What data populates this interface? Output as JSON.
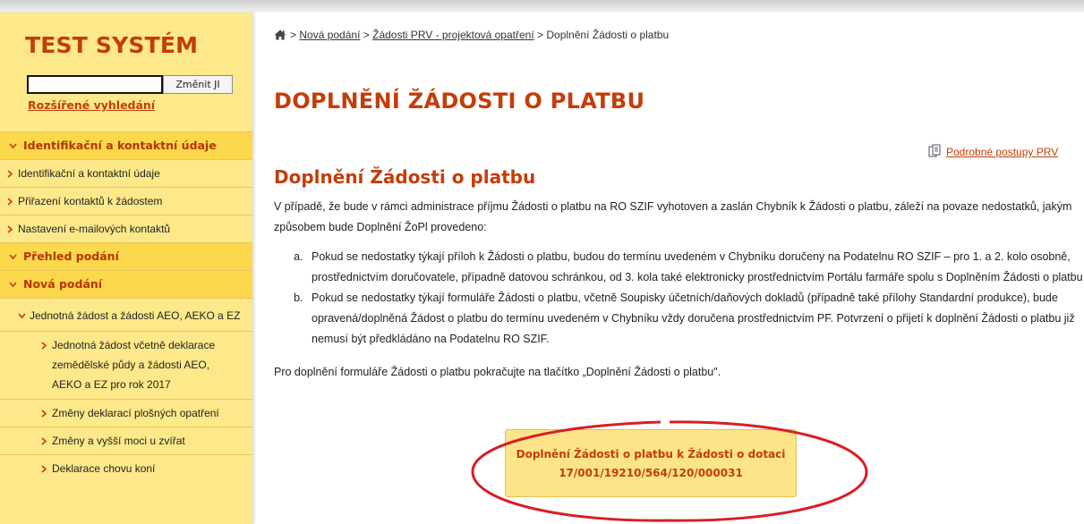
{
  "colors": {
    "accent": "#c43d08",
    "sidebar_bg": "#fde98a",
    "section_bg": "#fcd84d",
    "annotation": "#d81e26"
  },
  "sidebar": {
    "system_title": "TEST SYSTÉM",
    "search": {
      "value": "",
      "button_label": "Změnit JI"
    },
    "advanced_search": "Rozšířené vyhledání",
    "items": [
      {
        "label": "Identifikační a kontaktní údaje",
        "kind": "section"
      },
      {
        "label": "Identifikační a kontaktní údaje",
        "kind": "sub"
      },
      {
        "label": "Přiřazení kontaktů k žádostem",
        "kind": "sub"
      },
      {
        "label": "Nastavení e-mailových kontaktů",
        "kind": "sub"
      },
      {
        "label": "Přehled podání",
        "kind": "section"
      },
      {
        "label": "Nová podání",
        "kind": "section"
      },
      {
        "label": "Jednotná žádost a žádosti AEO, AEKO a EZ",
        "kind": "sub2"
      },
      {
        "label": "Jednotná žádost včetně deklarace zemědělské půdy a žádosti AEO, AEKO a EZ pro rok 2017",
        "kind": "sub3"
      },
      {
        "label": "Změny deklarací plošných opatření",
        "kind": "sub3"
      },
      {
        "label": "Změny a vyšší moci u zvířat",
        "kind": "sub3"
      },
      {
        "label": "Deklarace chovu koní",
        "kind": "sub3"
      }
    ]
  },
  "breadcrumb": {
    "home_icon": "home-icon",
    "links": [
      "Nová podání",
      "Žádosti PRV - projektová opatření"
    ],
    "current": "Doplnění Žádosti o platbu",
    "separator": ">"
  },
  "page_title": "DOPLNĚNÍ ŽÁDOSTI O PLATBU",
  "detail_link": "Podrobné postupy PRV",
  "section_title": "Doplnění Žádosti o platbu",
  "intro": "V případě, že bude v rámci administrace příjmu Žádosti o platbu na RO SZIF vyhotoven a zaslán Chybník k Žádosti o platbu, záleží na povaze nedostatků, jakým způsobem bude Doplnění ŽoPl provedeno:",
  "list": [
    "Pokud se nedostatky týkají příloh k Žádosti o platbu, budou do termínu uvedeném v Chybníku doručeny na Podatelnu RO SZIF – pro 1. a 2. kolo osobně, prostřednictvím doručovatele, případně datovou schránkou, od 3. kola také elektronicky prostřednictvím Portálu farmáře spolu s Doplněním Žádosti o platbu",
    "Pokud se nedostatky týkají formuláře Žádosti o platbu, včetně Soupisky účetních/daňových dokladů (případně také přílohy Standardní produkce), bude opravená/doplněná Žádost o platbu do termínu uvedeném v Chybníku vždy doručena prostřednictvím PF. Potvrzení o přijetí k doplnění Žádosti o platbu již nemusí být předkládáno na Podatelnu RO SZIF."
  ],
  "outro": "Pro doplnění formuláře Žádosti o platbu pokračujte na tlačítko „Doplnění Žádosti o platbu\".",
  "cta": {
    "line1": "Doplnění Žádosti o platbu k Žádosti o dotaci",
    "line2": "17/001/19210/564/120/000031"
  }
}
